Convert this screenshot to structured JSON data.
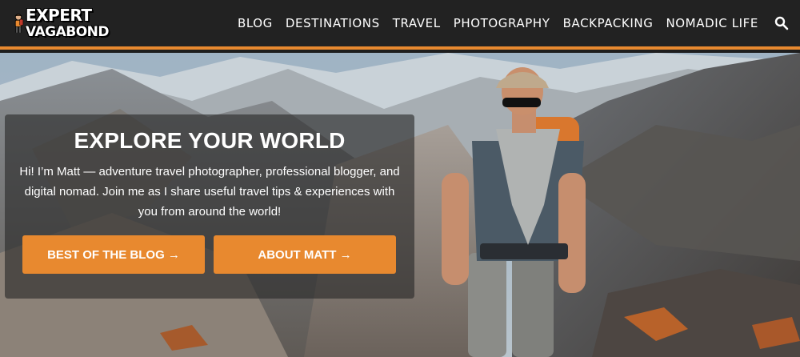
{
  "logo": {
    "line1": "EXPERT",
    "line2": "VAGABOND"
  },
  "nav": {
    "items": [
      "BLOG",
      "DESTINATIONS",
      "TRAVEL",
      "PHOTOGRAPHY",
      "BACKPACKING",
      "NOMADIC LIFE"
    ]
  },
  "icons": {
    "search": "search-icon",
    "mascot": "mascot-logo-icon"
  },
  "colors": {
    "accent": "#e8892f",
    "header_bg": "#222222"
  },
  "hero": {
    "title": "EXPLORE YOUR WORLD",
    "description": "Hi! I’m Matt — adventure travel photographer, professional blogger, and digital nomad. Join me as I share useful travel tips & experiences with you from around the world!",
    "button_blog": "BEST OF THE BLOG →",
    "button_about": "ABOUT MATT →"
  }
}
